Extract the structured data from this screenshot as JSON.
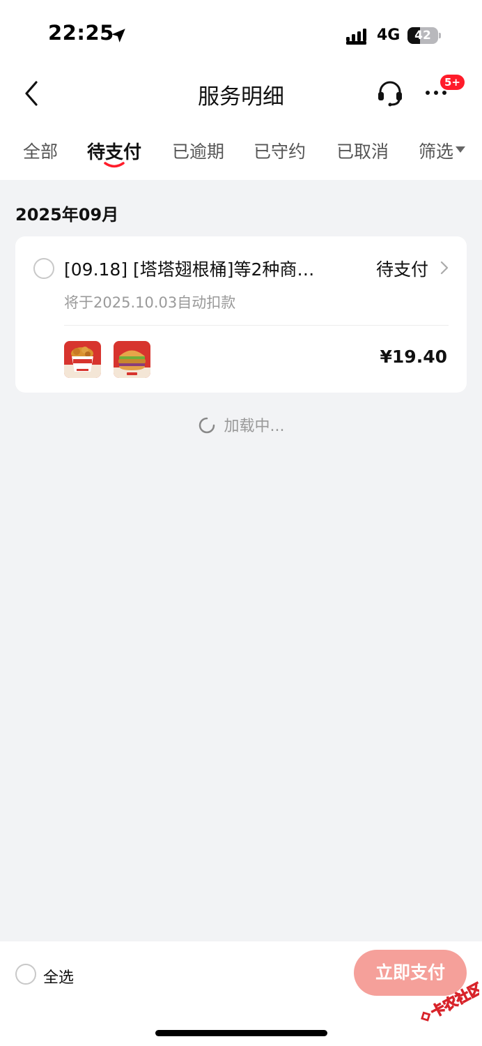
{
  "status_bar": {
    "time": "22:25",
    "network": "4G",
    "battery": "42",
    "battery_level": 0.42
  },
  "nav": {
    "title": "服务明细",
    "badge": "5+"
  },
  "tabs": [
    {
      "label": "全部"
    },
    {
      "label": "待支付"
    },
    {
      "label": "已逾期"
    },
    {
      "label": "已守约"
    },
    {
      "label": "已取消"
    },
    {
      "label": "筛选"
    }
  ],
  "active_tab_index": 1,
  "section": {
    "month": "2025年09月"
  },
  "order": {
    "title": "[09.18] [塔塔翅根桶]等2种商…",
    "status": "待支付",
    "subtitle": "将于2025.10.03自动扣款",
    "price": "¥19.40",
    "thumbnail_1_text": "塔塔翅根桶"
  },
  "loading_text": "加载中...",
  "bottom": {
    "select_all": "全选",
    "pay_button": "立即支付"
  },
  "watermark": "卡农社区",
  "colors": {
    "accent_red": "#ff1c2a",
    "pay_button": "#f5a09a",
    "page_bg": "#f2f3f5"
  }
}
